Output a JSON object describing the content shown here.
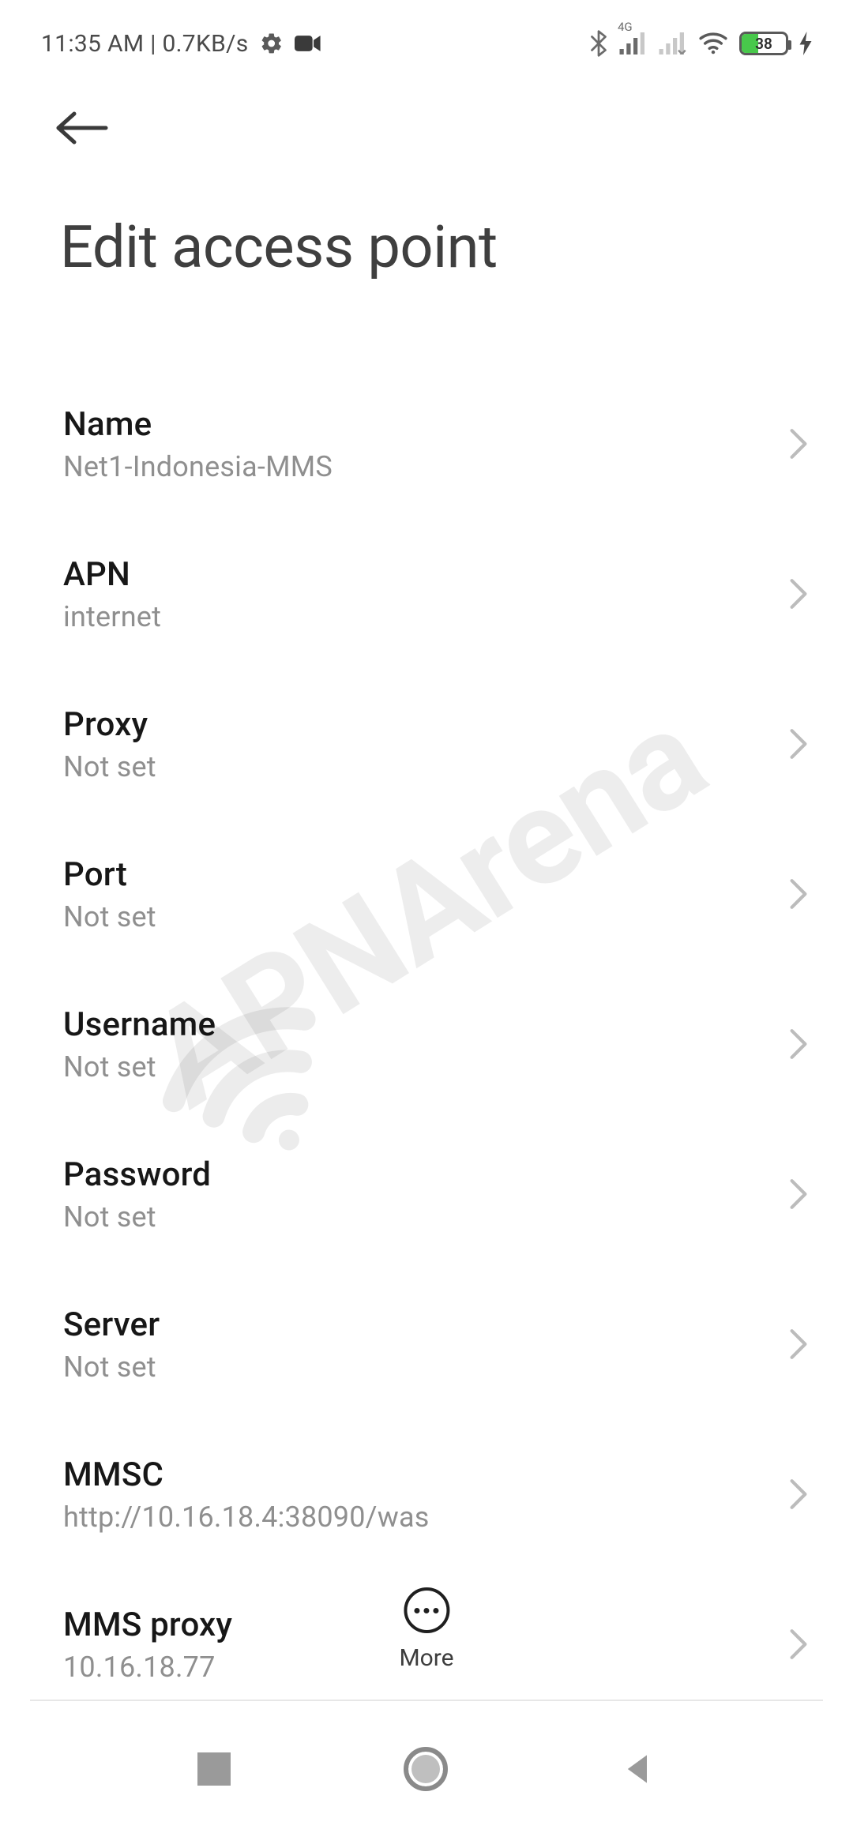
{
  "watermark_text": "APNArena",
  "status": {
    "time": "11:35 AM",
    "net_speed": "0.7KB/s",
    "battery_pct": "38",
    "signal_label_1": "4G"
  },
  "header": {
    "title": "Edit access point"
  },
  "rows": [
    {
      "label": "Name",
      "value": "Net1-Indonesia-MMS"
    },
    {
      "label": "APN",
      "value": "internet"
    },
    {
      "label": "Proxy",
      "value": "Not set"
    },
    {
      "label": "Port",
      "value": "Not set"
    },
    {
      "label": "Username",
      "value": "Not set"
    },
    {
      "label": "Password",
      "value": "Not set"
    },
    {
      "label": "Server",
      "value": "Not set"
    },
    {
      "label": "MMSC",
      "value": "http://10.16.18.4:38090/was"
    },
    {
      "label": "MMS proxy",
      "value": "10.16.18.77"
    }
  ],
  "more_label": "More"
}
